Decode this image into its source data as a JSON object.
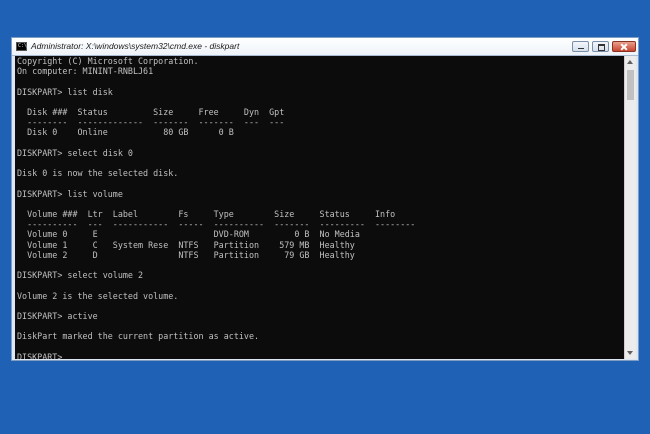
{
  "window": {
    "title": "Administrator: X:\\windows\\system32\\cmd.exe - diskpart",
    "icon": "cmd-icon"
  },
  "console": {
    "lines": [
      "Copyright (C) Microsoft Corporation.",
      "On computer: MININT-RNBLJ61",
      "",
      "DISKPART> list disk",
      "",
      "  Disk ###  Status         Size     Free     Dyn  Gpt",
      "  --------  -------------  -------  -------  ---  ---",
      "  Disk 0    Online           80 GB      0 B",
      "",
      "DISKPART> select disk 0",
      "",
      "Disk 0 is now the selected disk.",
      "",
      "DISKPART> list volume",
      "",
      "  Volume ###  Ltr  Label        Fs     Type        Size     Status     Info",
      "  ----------  ---  -----------  -----  ----------  -------  ---------  --------",
      "  Volume 0     E                       DVD-ROM         0 B  No Media",
      "  Volume 1     C   System Rese  NTFS   Partition    579 MB  Healthy",
      "  Volume 2     D                NTFS   Partition     79 GB  Healthy",
      "",
      "DISKPART> select volume 2",
      "",
      "Volume 2 is the selected volume.",
      "",
      "DISKPART> active",
      "",
      "DiskPart marked the current partition as active.",
      "",
      "DISKPART> "
    ]
  },
  "colors": {
    "desktop": "#1f62b5",
    "console_bg": "#0c0c0c",
    "console_fg": "#c0c0c0"
  }
}
